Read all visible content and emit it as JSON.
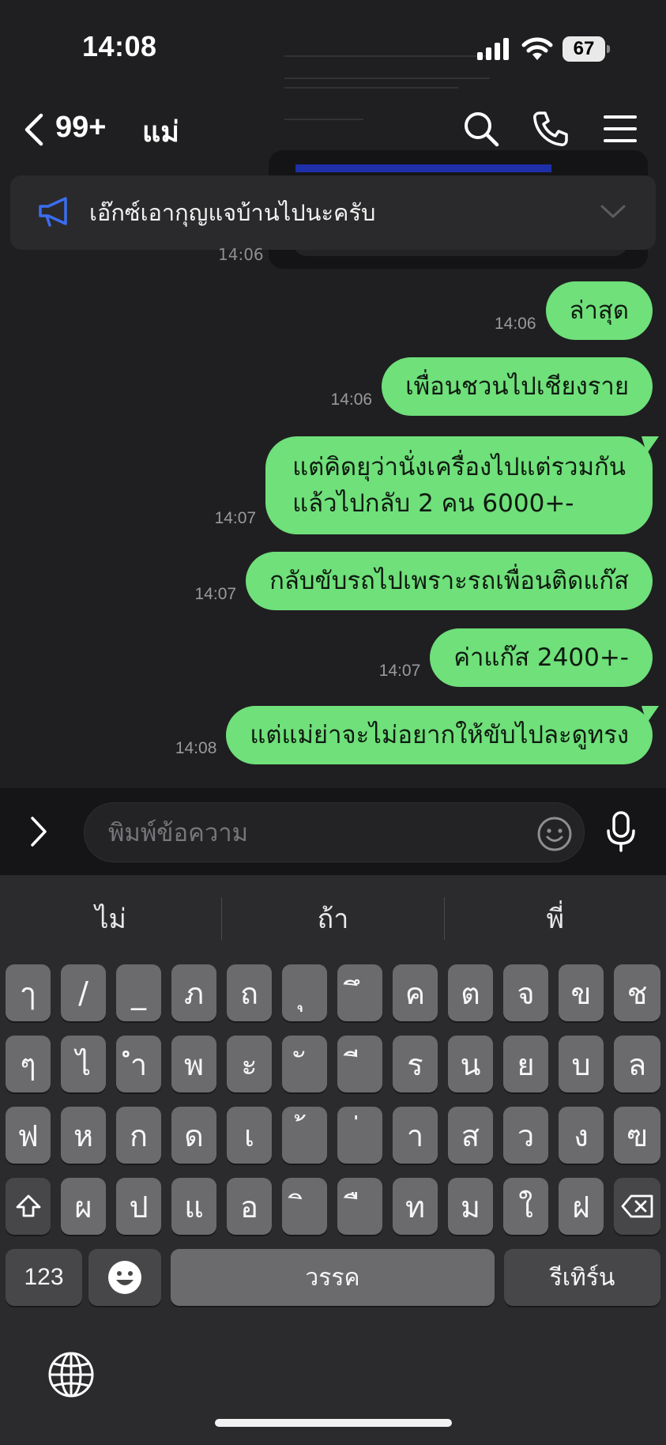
{
  "status_bar": {
    "time": "14:08",
    "battery": "67"
  },
  "header": {
    "unread_count": "99+",
    "title": "แม่"
  },
  "announcement": {
    "text": "เอ๊กซ์เอากุญแจบ้านไปนะครับ"
  },
  "stray_time": "14:06",
  "messages": [
    {
      "time": "14:06",
      "lines": [
        "ล่าสุด"
      ]
    },
    {
      "time": "14:06",
      "lines": [
        "เพื่อนชวนไปเชียงราย"
      ]
    },
    {
      "time": "14:07",
      "lines": [
        "แต่คิดยุว่านั่งเครื่องไปแต่รวมกัน",
        "แล้วไปกลับ 2 คน 6000+-"
      ]
    },
    {
      "time": "14:07",
      "lines": [
        "กลับขับรถไปเพราะรถเพื่อนติดแก๊ส"
      ]
    },
    {
      "time": "14:07",
      "lines": [
        "ค่าแก๊ส 2400+-"
      ]
    },
    {
      "time": "14:08",
      "lines": [
        "แต่แม่ย่าจะไม่อยากให้ขับไปละดูทรง"
      ]
    }
  ],
  "input": {
    "placeholder": "พิมพ์ข้อความ"
  },
  "keyboard": {
    "suggestions": [
      "ไม่",
      "ถ้า",
      "พี่"
    ],
    "row1": [
      "ๅ",
      "/",
      "_",
      "ภ",
      "ถ",
      "ุ",
      "ึ",
      "ค",
      "ต",
      "จ",
      "ข",
      "ช"
    ],
    "row2": [
      "ๆ",
      "ไ",
      "ำ",
      "พ",
      "ะ",
      "ั",
      "ี",
      "ร",
      "น",
      "ย",
      "บ",
      "ล"
    ],
    "row3": [
      "ฟ",
      "ห",
      "ก",
      "ด",
      "เ",
      "้",
      "่",
      "า",
      "ส",
      "ว",
      "ง",
      "ฃ"
    ],
    "row4": [
      "ผ",
      "ป",
      "แ",
      "อ",
      "ิ",
      "ื",
      "ท",
      "ม",
      "ใ",
      "ฝ"
    ],
    "numbers_key": "123",
    "space_key": "วรรค",
    "return_key": "รีเทิร์น"
  },
  "icons": {
    "signal": "signal-bars-icon",
    "wifi": "wifi-icon",
    "back": "chevron-left-icon",
    "search": "search-icon",
    "phone": "phone-icon",
    "menu": "hamburger-menu-icon",
    "announcement": "megaphone-icon",
    "expand": "chevron-right-icon",
    "emoji": "emoji-face-icon",
    "mic": "microphone-icon",
    "globe": "globe-icon",
    "shift": "shift-icon",
    "delete": "backspace-icon"
  },
  "colors": {
    "bubble": "#6fe07a",
    "accent_blue": "#3b6df0",
    "background": "#1f1f21"
  }
}
